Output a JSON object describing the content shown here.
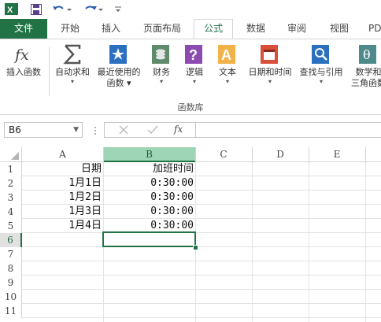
{
  "qat": {
    "icons": [
      "excel-logo",
      "save-icon",
      "undo-icon",
      "redo-icon",
      "customize-qat-icon"
    ]
  },
  "tabs": [
    {
      "id": "file",
      "label": "文件"
    },
    {
      "id": "home",
      "label": "开始"
    },
    {
      "id": "insert",
      "label": "插入"
    },
    {
      "id": "layout",
      "label": "页面布局"
    },
    {
      "id": "formulas",
      "label": "公式",
      "active": true
    },
    {
      "id": "data",
      "label": "数据"
    },
    {
      "id": "review",
      "label": "审阅"
    },
    {
      "id": "view",
      "label": "视图"
    },
    {
      "id": "pdf",
      "label": "PD"
    }
  ],
  "ribbon": {
    "group_label": "函数库",
    "buttons": {
      "insert_function": {
        "line1": "插入函数"
      },
      "autosum": {
        "line1": "自动求和",
        "arrow": "▾"
      },
      "recent": {
        "line1": "最近使用的",
        "line2": "函数 ▾"
      },
      "financial": {
        "line1": "财务",
        "arrow": "▾"
      },
      "logical": {
        "line1": "逻辑",
        "arrow": "▾"
      },
      "text": {
        "line1": "文本",
        "arrow": "▾"
      },
      "datetime": {
        "line1": "日期和时间",
        "arrow": "▾"
      },
      "lookup": {
        "line1": "查找与引用",
        "arrow": "▾"
      },
      "math": {
        "line1": "数学和",
        "line2": "三角函数"
      }
    }
  },
  "formula_bar": {
    "name_box": "B6",
    "fx_label": "fx",
    "value": ""
  },
  "sheet": {
    "columns": [
      "A",
      "B",
      "C",
      "D",
      "E"
    ],
    "rows": [
      "1",
      "2",
      "3",
      "4",
      "5",
      "6",
      "7",
      "8",
      "9",
      "10",
      "11"
    ],
    "selected_cell": "B6",
    "cells": {
      "A1": "日期",
      "B1": "加班时间",
      "A2": "1月1日",
      "B2": "0:30:00",
      "A3": "1月2日",
      "B3": "0:30:00",
      "A4": "1月3日",
      "B4": "0:30:00",
      "A5": "1月4日",
      "B5": "0:30:00"
    }
  },
  "colors": {
    "accent": "#217346",
    "header_selected": "#9fd5b7"
  }
}
